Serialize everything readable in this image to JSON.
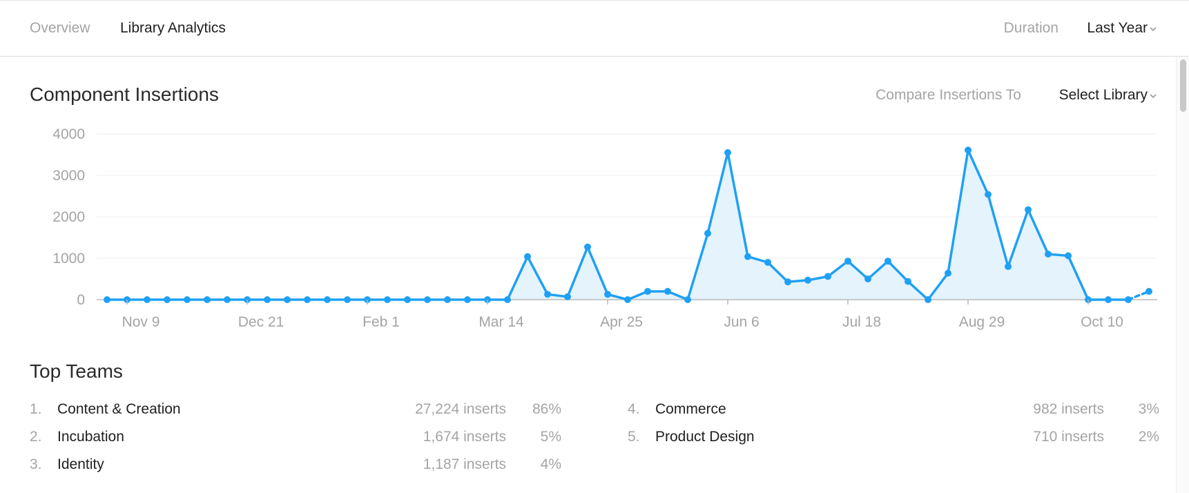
{
  "header": {
    "tabs": [
      {
        "label": "Overview",
        "active": false
      },
      {
        "label": "Library Analytics",
        "active": true
      }
    ],
    "duration_label": "Duration",
    "duration_value": "Last Year"
  },
  "insertions": {
    "title": "Component Insertions",
    "compare_label": "Compare Insertions To",
    "compare_value": "Select Library"
  },
  "chart_data": {
    "type": "area",
    "color": "#1fa0f5",
    "fill": "#e4f3fc",
    "grid": true,
    "ylim": [
      0,
      4000
    ],
    "yticks": [
      0,
      1000,
      2000,
      3000,
      4000
    ],
    "xtick_labels": [
      "Nov 9",
      "Dec 21",
      "Feb 1",
      "Mar 14",
      "Apr 25",
      "Jun 6",
      "Jul 18",
      "Aug 29",
      "Oct 10"
    ],
    "values": [
      0,
      0,
      0,
      0,
      0,
      0,
      0,
      0,
      0,
      0,
      0,
      0,
      0,
      0,
      0,
      0,
      0,
      0,
      0,
      0,
      0,
      1040,
      130,
      70,
      1270,
      130,
      0,
      200,
      200,
      0,
      1600,
      3550,
      1040,
      900,
      430,
      470,
      560,
      930,
      500,
      930,
      440,
      0,
      640,
      3610,
      2540,
      800,
      2170,
      1100,
      1060,
      0,
      0,
      0
    ],
    "partial_value": 200
  },
  "top_teams": {
    "title": "Top Teams",
    "teams": [
      {
        "rank": "1.",
        "name": "Content & Creation",
        "inserts": "27,224 inserts",
        "pct": "86%"
      },
      {
        "rank": "2.",
        "name": "Incubation",
        "inserts": "1,674 inserts",
        "pct": "5%"
      },
      {
        "rank": "3.",
        "name": "Identity",
        "inserts": "1,187 inserts",
        "pct": "4%"
      },
      {
        "rank": "4.",
        "name": "Commerce",
        "inserts": "982 inserts",
        "pct": "3%"
      },
      {
        "rank": "5.",
        "name": "Product Design",
        "inserts": "710 inserts",
        "pct": "2%"
      }
    ]
  }
}
